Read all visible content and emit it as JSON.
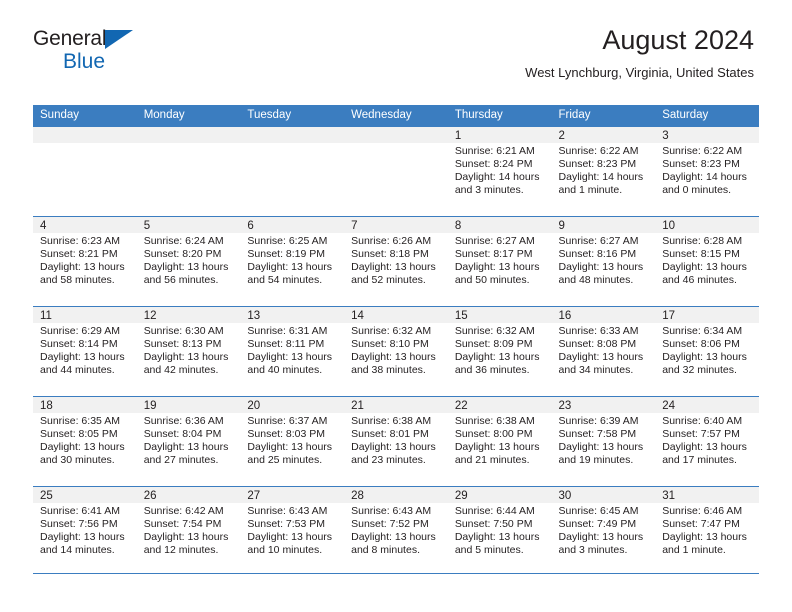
{
  "brand": {
    "name_line1": "General",
    "name_line2": "Blue",
    "accent_color": "#1267b2"
  },
  "header": {
    "title": "August 2024",
    "subtitle": "West Lynchburg, Virginia, United States"
  },
  "theme": {
    "header_row_bg": "#3b7dc0",
    "header_row_text": "#ffffff",
    "daynum_strip_bg": "#f1f1f1",
    "grid_line": "#3b7dc0",
    "body_text": "#231f20"
  },
  "calendar": {
    "weekday_headers": [
      "Sunday",
      "Monday",
      "Tuesday",
      "Wednesday",
      "Thursday",
      "Friday",
      "Saturday"
    ],
    "weeks": [
      [
        {
          "day": "",
          "lines": []
        },
        {
          "day": "",
          "lines": []
        },
        {
          "day": "",
          "lines": []
        },
        {
          "day": "",
          "lines": []
        },
        {
          "day": "1",
          "lines": [
            "Sunrise: 6:21 AM",
            "Sunset: 8:24 PM",
            "Daylight: 14 hours",
            "and 3 minutes."
          ]
        },
        {
          "day": "2",
          "lines": [
            "Sunrise: 6:22 AM",
            "Sunset: 8:23 PM",
            "Daylight: 14 hours",
            "and 1 minute."
          ]
        },
        {
          "day": "3",
          "lines": [
            "Sunrise: 6:22 AM",
            "Sunset: 8:23 PM",
            "Daylight: 14 hours",
            "and 0 minutes."
          ]
        }
      ],
      [
        {
          "day": "4",
          "lines": [
            "Sunrise: 6:23 AM",
            "Sunset: 8:21 PM",
            "Daylight: 13 hours",
            "and 58 minutes."
          ]
        },
        {
          "day": "5",
          "lines": [
            "Sunrise: 6:24 AM",
            "Sunset: 8:20 PM",
            "Daylight: 13 hours",
            "and 56 minutes."
          ]
        },
        {
          "day": "6",
          "lines": [
            "Sunrise: 6:25 AM",
            "Sunset: 8:19 PM",
            "Daylight: 13 hours",
            "and 54 minutes."
          ]
        },
        {
          "day": "7",
          "lines": [
            "Sunrise: 6:26 AM",
            "Sunset: 8:18 PM",
            "Daylight: 13 hours",
            "and 52 minutes."
          ]
        },
        {
          "day": "8",
          "lines": [
            "Sunrise: 6:27 AM",
            "Sunset: 8:17 PM",
            "Daylight: 13 hours",
            "and 50 minutes."
          ]
        },
        {
          "day": "9",
          "lines": [
            "Sunrise: 6:27 AM",
            "Sunset: 8:16 PM",
            "Daylight: 13 hours",
            "and 48 minutes."
          ]
        },
        {
          "day": "10",
          "lines": [
            "Sunrise: 6:28 AM",
            "Sunset: 8:15 PM",
            "Daylight: 13 hours",
            "and 46 minutes."
          ]
        }
      ],
      [
        {
          "day": "11",
          "lines": [
            "Sunrise: 6:29 AM",
            "Sunset: 8:14 PM",
            "Daylight: 13 hours",
            "and 44 minutes."
          ]
        },
        {
          "day": "12",
          "lines": [
            "Sunrise: 6:30 AM",
            "Sunset: 8:13 PM",
            "Daylight: 13 hours",
            "and 42 minutes."
          ]
        },
        {
          "day": "13",
          "lines": [
            "Sunrise: 6:31 AM",
            "Sunset: 8:11 PM",
            "Daylight: 13 hours",
            "and 40 minutes."
          ]
        },
        {
          "day": "14",
          "lines": [
            "Sunrise: 6:32 AM",
            "Sunset: 8:10 PM",
            "Daylight: 13 hours",
            "and 38 minutes."
          ]
        },
        {
          "day": "15",
          "lines": [
            "Sunrise: 6:32 AM",
            "Sunset: 8:09 PM",
            "Daylight: 13 hours",
            "and 36 minutes."
          ]
        },
        {
          "day": "16",
          "lines": [
            "Sunrise: 6:33 AM",
            "Sunset: 8:08 PM",
            "Daylight: 13 hours",
            "and 34 minutes."
          ]
        },
        {
          "day": "17",
          "lines": [
            "Sunrise: 6:34 AM",
            "Sunset: 8:06 PM",
            "Daylight: 13 hours",
            "and 32 minutes."
          ]
        }
      ],
      [
        {
          "day": "18",
          "lines": [
            "Sunrise: 6:35 AM",
            "Sunset: 8:05 PM",
            "Daylight: 13 hours",
            "and 30 minutes."
          ]
        },
        {
          "day": "19",
          "lines": [
            "Sunrise: 6:36 AM",
            "Sunset: 8:04 PM",
            "Daylight: 13 hours",
            "and 27 minutes."
          ]
        },
        {
          "day": "20",
          "lines": [
            "Sunrise: 6:37 AM",
            "Sunset: 8:03 PM",
            "Daylight: 13 hours",
            "and 25 minutes."
          ]
        },
        {
          "day": "21",
          "lines": [
            "Sunrise: 6:38 AM",
            "Sunset: 8:01 PM",
            "Daylight: 13 hours",
            "and 23 minutes."
          ]
        },
        {
          "day": "22",
          "lines": [
            "Sunrise: 6:38 AM",
            "Sunset: 8:00 PM",
            "Daylight: 13 hours",
            "and 21 minutes."
          ]
        },
        {
          "day": "23",
          "lines": [
            "Sunrise: 6:39 AM",
            "Sunset: 7:58 PM",
            "Daylight: 13 hours",
            "and 19 minutes."
          ]
        },
        {
          "day": "24",
          "lines": [
            "Sunrise: 6:40 AM",
            "Sunset: 7:57 PM",
            "Daylight: 13 hours",
            "and 17 minutes."
          ]
        }
      ],
      [
        {
          "day": "25",
          "lines": [
            "Sunrise: 6:41 AM",
            "Sunset: 7:56 PM",
            "Daylight: 13 hours",
            "and 14 minutes."
          ]
        },
        {
          "day": "26",
          "lines": [
            "Sunrise: 6:42 AM",
            "Sunset: 7:54 PM",
            "Daylight: 13 hours",
            "and 12 minutes."
          ]
        },
        {
          "day": "27",
          "lines": [
            "Sunrise: 6:43 AM",
            "Sunset: 7:53 PM",
            "Daylight: 13 hours",
            "and 10 minutes."
          ]
        },
        {
          "day": "28",
          "lines": [
            "Sunrise: 6:43 AM",
            "Sunset: 7:52 PM",
            "Daylight: 13 hours",
            "and 8 minutes."
          ]
        },
        {
          "day": "29",
          "lines": [
            "Sunrise: 6:44 AM",
            "Sunset: 7:50 PM",
            "Daylight: 13 hours",
            "and 5 minutes."
          ]
        },
        {
          "day": "30",
          "lines": [
            "Sunrise: 6:45 AM",
            "Sunset: 7:49 PM",
            "Daylight: 13 hours",
            "and 3 minutes."
          ]
        },
        {
          "day": "31",
          "lines": [
            "Sunrise: 6:46 AM",
            "Sunset: 7:47 PM",
            "Daylight: 13 hours",
            "and 1 minute."
          ]
        }
      ]
    ]
  }
}
